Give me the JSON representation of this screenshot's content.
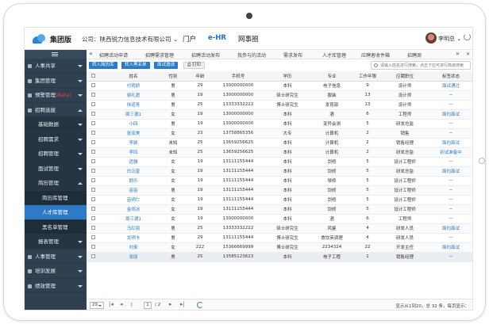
{
  "header": {
    "brand": "集团版",
    "company": "公司：陕西锐力信息技术有限公司",
    "nav": [
      "门户",
      "e-HR",
      "网事圈"
    ],
    "nav_active": 1,
    "user": "李明总"
  },
  "sidebar": {
    "items": [
      {
        "label": "人事共享",
        "level": 0,
        "expanded": false
      },
      {
        "label": "集团管理",
        "level": 0,
        "expanded": false
      },
      {
        "label": "预警管理",
        "badge": "(Beta)",
        "level": 0,
        "expanded": false
      },
      {
        "label": "招聘选拔",
        "level": 0,
        "expanded": true
      },
      {
        "label": "基础数据",
        "level": 1,
        "expanded": false
      },
      {
        "label": "招聘需求",
        "level": 1,
        "expanded": false
      },
      {
        "label": "招聘管理",
        "level": 1,
        "expanded": false
      },
      {
        "label": "面试管理",
        "level": 1,
        "expanded": false
      },
      {
        "label": "简历管理",
        "level": 1,
        "expanded": true
      },
      {
        "label": "简历库管理",
        "level": 2
      },
      {
        "label": "人才库管理",
        "level": 2,
        "active": true
      },
      {
        "label": "黑名单管理",
        "level": 2
      },
      {
        "label": "报表管理",
        "level": 1,
        "expanded": false
      },
      {
        "label": "人事管理",
        "level": 0,
        "expanded": false
      },
      {
        "label": "培训发展",
        "level": 0,
        "expanded": false
      },
      {
        "label": "绩效管理",
        "level": 0,
        "expanded": false
      }
    ]
  },
  "tabs": [
    "招聘活动申请",
    "招聘需求管理",
    "招聘活动发布",
    "我参与的活动",
    "需求发布",
    "人才库管理",
    "应聘者收件箱",
    "招聘周"
  ],
  "toolbar": {
    "buttons": [
      "转入简历库",
      "转入黑名单",
      "面试邀请",
      "打印"
    ],
    "search_placeholder": "请输入姓名进行搜索，点击下拉可进行高级搜索"
  },
  "table": {
    "columns": [
      "姓名",
      "性别",
      "年龄",
      "手机号",
      "学历",
      "专业",
      "工作年限",
      "应聘职位",
      "标签状态"
    ],
    "rows": [
      [
        "付艳娇",
        "男",
        "29",
        "13000000000",
        "本科",
        "电子信息",
        "9",
        "设计师",
        "面试通过"
      ],
      [
        "谢礼君",
        "男",
        "19",
        "13000000000",
        "硕士研究生",
        "服装",
        "13",
        "设计师",
        "--"
      ],
      [
        "徐道青",
        "男",
        "25",
        "13333332222",
        "博士研究生",
        "发育部",
        "13",
        "设计师",
        "--"
      ],
      [
        "周三德1",
        "女",
        "19",
        "13000000000",
        "本科",
        "酒",
        "6",
        "工程师",
        "面约面试"
      ],
      [
        "小四",
        "男",
        "19",
        "13000000000",
        "本科",
        "变异会测",
        "5",
        "研发总监",
        "--"
      ],
      [
        "张双美",
        "女",
        "23",
        "13758865356",
        "大专",
        "计算机",
        "2",
        "销售",
        "--"
      ],
      [
        "李颖",
        "未知",
        "25",
        "13659256625",
        "本科",
        "计算机",
        "2",
        "销售经理",
        "面约面试"
      ],
      [
        "李四",
        "未知",
        "25",
        "13659256625",
        "本科",
        "计算机",
        "2",
        "研发总监",
        "初试准备中"
      ],
      [
        "遗雅",
        "女",
        "19",
        "13111155444",
        "本科",
        "剑修",
        "5",
        "设计工程师",
        "--"
      ],
      [
        "白沉奎",
        "女",
        "19",
        "13111155444",
        "本科",
        "剑修",
        "5",
        "研发总监",
        "面约面试"
      ],
      [
        "顾乐",
        "女",
        "19",
        "13111155444",
        "本科",
        "琴修",
        "5",
        "设计工程师",
        "--"
      ],
      [
        "苗苗",
        "男",
        "19",
        "13111155444",
        "本科",
        "剑修",
        "5",
        "设计工程师",
        "--"
      ],
      [
        "苗明仁",
        "女",
        "19",
        "13111155444",
        "本科",
        "剑修",
        "5",
        "设计工程师",
        "--"
      ],
      [
        "金雨冰",
        "女",
        "19",
        "13111155444",
        "本科",
        "剑修",
        "5",
        "设计工程师",
        "--"
      ],
      [
        "周三德1",
        "女",
        "19",
        "13000000000",
        "本科",
        "酒",
        "6",
        "工程师",
        "--"
      ],
      [
        "马红丽",
        "男",
        "25",
        "13333332222",
        "硕士研究生",
        "风鉴",
        "4",
        "研发人员",
        "面约面试"
      ],
      [
        "龙明卡",
        "男",
        "29",
        "13111155444",
        "博士研究生",
        "食饮英调理",
        "4",
        "研发人员",
        "--"
      ],
      [
        "刘来",
        "女",
        "222",
        "15366669999",
        "博士研究生",
        "2234324",
        "22",
        "开发主任",
        "面约面试"
      ],
      [
        "张丽",
        "男",
        "25",
        "13585123623",
        "本科",
        "电子工程",
        "1",
        "销售经理",
        "--"
      ]
    ]
  },
  "footer": {
    "page_size": "20",
    "page_current": "1",
    "page_total_text": "/ 2",
    "info": "显示从1到20，总 32 条，每页显示："
  }
}
